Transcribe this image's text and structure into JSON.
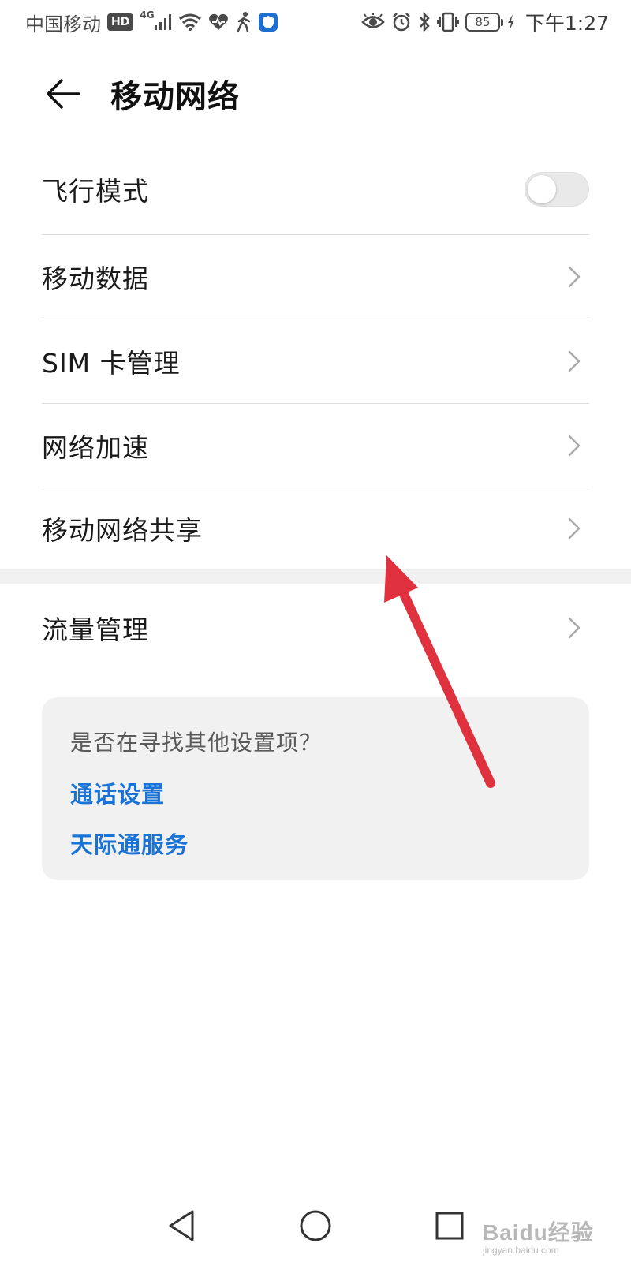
{
  "status_bar": {
    "carrier": "中国移动",
    "hd": "HD",
    "network": "4G",
    "battery": "85",
    "time": "下午1:27"
  },
  "header": {
    "title": "移动网络"
  },
  "list": {
    "airplane_mode": {
      "label": "飞行模式",
      "enabled": false
    },
    "mobile_data": {
      "label": "移动数据"
    },
    "sim_management": {
      "label": "SIM 卡管理"
    },
    "network_acceleration": {
      "label": "网络加速"
    },
    "tethering": {
      "label": "移动网络共享"
    },
    "data_usage": {
      "label": "流量管理"
    }
  },
  "suggestion_card": {
    "question": "是否在寻找其他设置项？",
    "links": [
      "通话设置",
      "天际通服务"
    ]
  },
  "watermark": {
    "main": "Baidu经验",
    "sub": "jingyan.baidu.com"
  },
  "colors": {
    "link": "#1a73d6",
    "annotation_arrow": "#e0313f",
    "card_background": "#f1f1f1"
  }
}
